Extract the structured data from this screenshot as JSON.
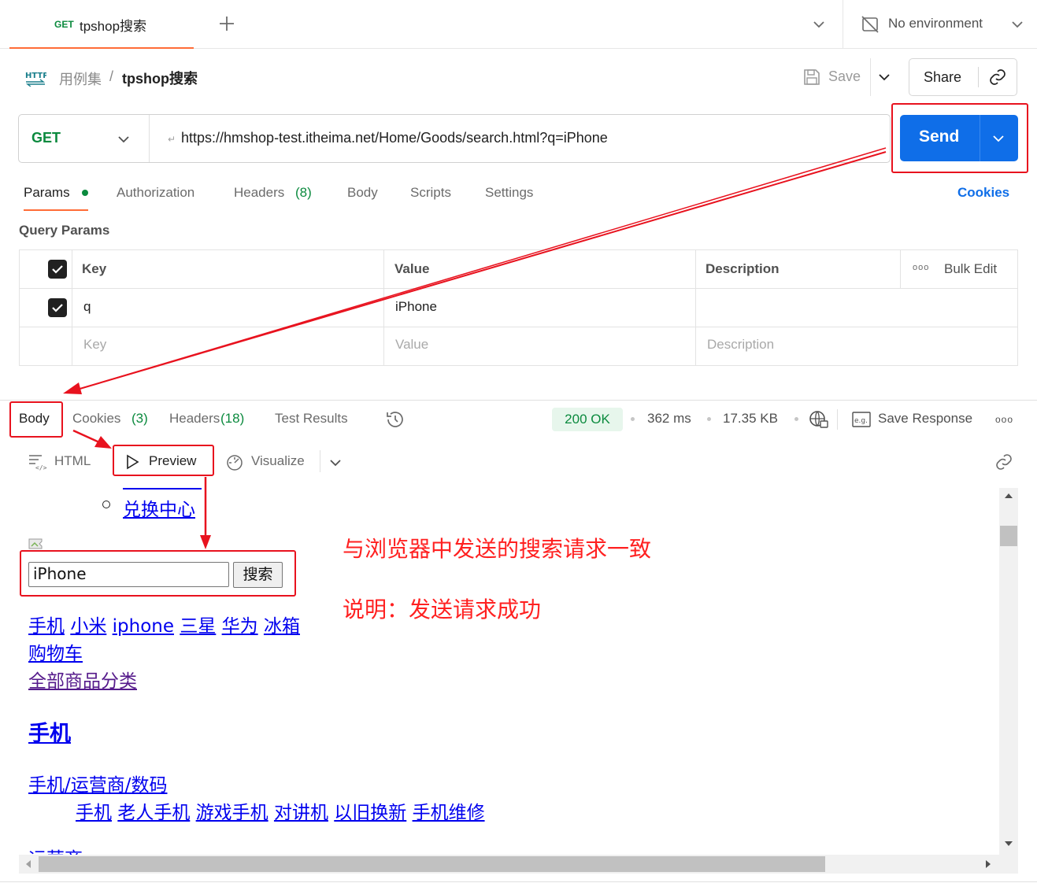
{
  "tab": {
    "method": "GET",
    "name": "tpshop搜索"
  },
  "environment": {
    "label": "No environment"
  },
  "breadcrumb": {
    "collection": "用例集",
    "separator": "/",
    "request": "tpshop搜索"
  },
  "toolbar": {
    "save_label": "Save",
    "share_label": "Share"
  },
  "request": {
    "method": "GET",
    "url": "https://hmshop-test.itheima.net/Home/Goods/search.html?q=iPhone",
    "send_label": "Send"
  },
  "request_tabs": {
    "params": "Params",
    "authorization": "Authorization",
    "headers": "Headers",
    "headers_count": "(8)",
    "body": "Body",
    "scripts": "Scripts",
    "settings": "Settings",
    "cookies": "Cookies"
  },
  "query_params": {
    "title": "Query Params",
    "columns": {
      "key": "Key",
      "value": "Value",
      "description": "Description",
      "bulk_edit": "Bulk Edit"
    },
    "rows": [
      {
        "key": "q",
        "value": "iPhone",
        "description": ""
      }
    ],
    "placeholder": {
      "key": "Key",
      "value": "Value",
      "description": "Description"
    }
  },
  "response_tabs": {
    "body": "Body",
    "cookies": "Cookies",
    "cookies_count": "(3)",
    "headers": "Headers",
    "headers_count": "(18)",
    "test_results": "Test Results"
  },
  "response_meta": {
    "status": "200 OK",
    "time": "362 ms",
    "size": "17.35 KB",
    "save_response": "Save Response"
  },
  "view_modes": {
    "html": "HTML",
    "preview": "Preview",
    "visualize": "Visualize"
  },
  "preview": {
    "list_item": "兑换中心",
    "search_value": "iPhone",
    "search_button": "搜索",
    "hot_links": [
      "手机",
      "小米",
      "iphone",
      "三星",
      "华为",
      "冰箱"
    ],
    "cart_link": "购物车",
    "all_categories": "全部商品分类",
    "category_heading": "手机",
    "subcategory_title": "手机/运营商/数码",
    "subcategory_links": [
      "手机",
      "老人手机",
      "游戏手机",
      "对讲机",
      "以旧换新",
      "手机维修"
    ],
    "cutoff_text": "运营商"
  },
  "annotations": {
    "line1": "与浏览器中发送的搜索请求一致",
    "line2": "说明：发送请求成功"
  },
  "colors": {
    "accent_orange": "#ff6c37",
    "send_blue": "#0f6ee8",
    "annotation_red": "#e8121e",
    "success_green": "#0b8a3e"
  }
}
